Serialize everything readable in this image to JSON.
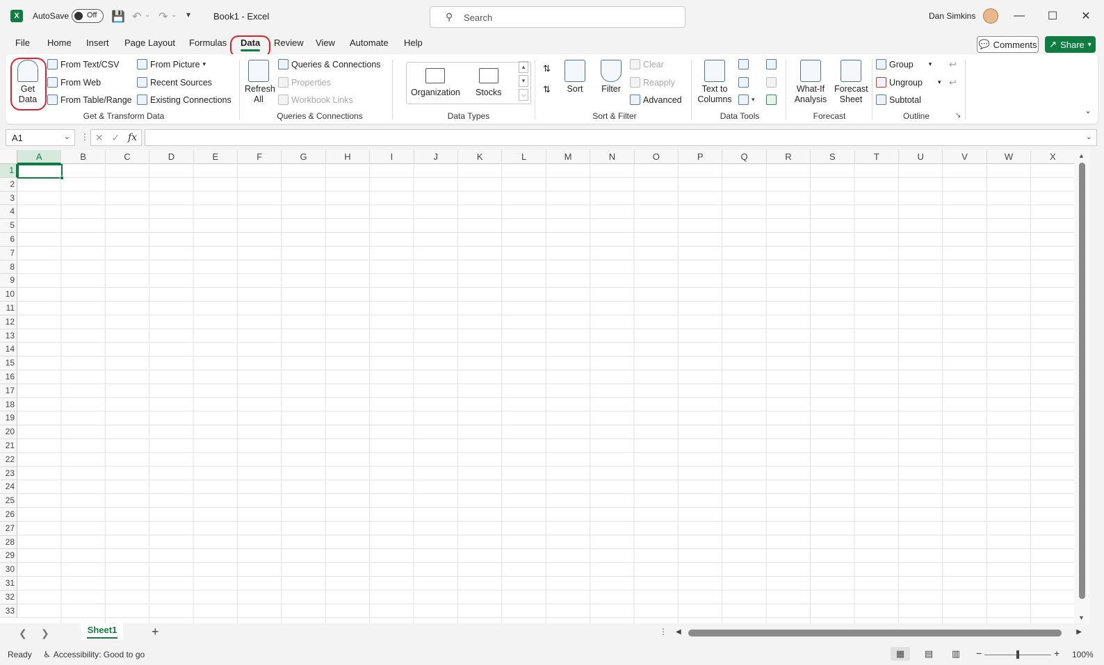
{
  "titlebar": {
    "autosave_label": "AutoSave",
    "autosave_state": "Off",
    "title": "Book1 - Excel",
    "search_placeholder": "Search",
    "user_name": "Dan Simkins"
  },
  "tabs": [
    "File",
    "Home",
    "Insert",
    "Page Layout",
    "Formulas",
    "Data",
    "Review",
    "View",
    "Automate",
    "Help"
  ],
  "active_tab": "Data",
  "actions": {
    "comments": "Comments",
    "share": "Share"
  },
  "ribbon": {
    "get_transform": {
      "get_data": "Get Data",
      "from_text_csv": "From Text/CSV",
      "from_web": "From Web",
      "from_table_range": "From Table/Range",
      "from_picture": "From Picture",
      "recent_sources": "Recent Sources",
      "existing_connections": "Existing Connections",
      "label": "Get & Transform Data"
    },
    "queries": {
      "refresh_all": "Refresh All",
      "queries_connections": "Queries & Connections",
      "properties": "Properties",
      "workbook_links": "Workbook Links",
      "label": "Queries & Connections"
    },
    "data_types": {
      "organization": "Organization",
      "stocks": "Stocks",
      "label": "Data Types"
    },
    "sort_filter": {
      "sort": "Sort",
      "filter": "Filter",
      "clear": "Clear",
      "reapply": "Reapply",
      "advanced": "Advanced",
      "label": "Sort & Filter"
    },
    "data_tools": {
      "text_to_columns": "Text to Columns",
      "label": "Data Tools"
    },
    "forecast": {
      "what_if": "What-If Analysis",
      "forecast_sheet": "Forecast Sheet",
      "label": "Forecast"
    },
    "outline": {
      "group": "Group",
      "ungroup": "Ungroup",
      "subtotal": "Subtotal",
      "label": "Outline"
    }
  },
  "formula_bar": {
    "name_box": "A1",
    "formula": ""
  },
  "grid": {
    "columns": [
      "A",
      "B",
      "C",
      "D",
      "E",
      "F",
      "G",
      "H",
      "I",
      "J",
      "K",
      "L",
      "M",
      "N",
      "O",
      "P",
      "Q",
      "R",
      "S",
      "T",
      "U",
      "V",
      "W",
      "X"
    ],
    "rows": [
      "1",
      "2",
      "3",
      "4",
      "5",
      "6",
      "7",
      "8",
      "9",
      "10",
      "11",
      "12",
      "13",
      "14",
      "15",
      "16",
      "17",
      "18",
      "19",
      "20",
      "21",
      "22",
      "23",
      "24",
      "25",
      "26",
      "27",
      "28",
      "29",
      "30",
      "31",
      "32",
      "33"
    ],
    "selected_cell": "A1"
  },
  "sheets": [
    "Sheet1"
  ],
  "status": {
    "ready": "Ready",
    "accessibility": "Accessibility: Good to go",
    "zoom": "100%"
  },
  "colors": {
    "accent": "#107c41",
    "highlight_ring": "#e0202a"
  }
}
